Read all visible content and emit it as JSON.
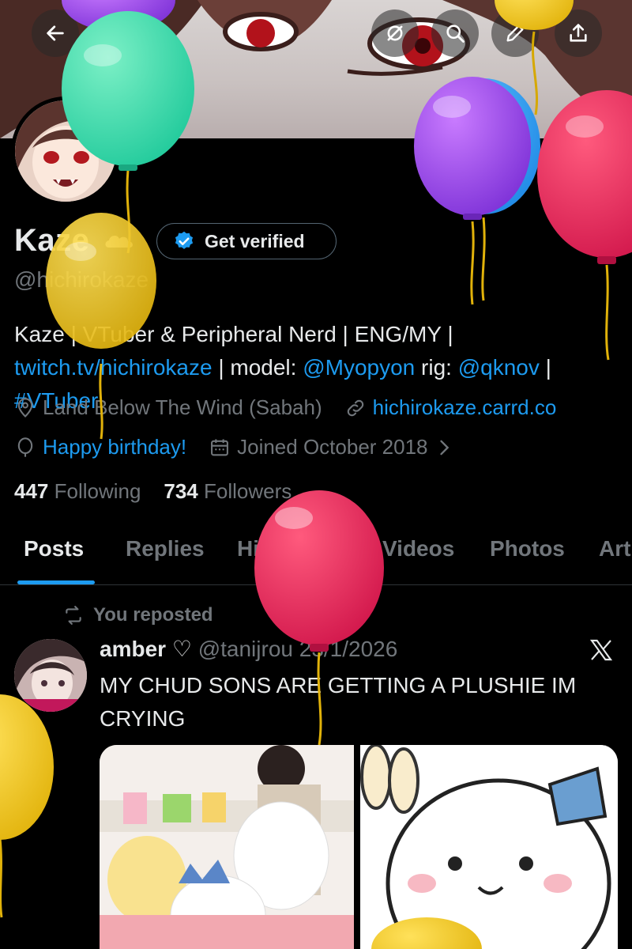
{
  "header": {
    "back_icon": "arrow-left-icon",
    "actions": [
      "mute-icon",
      "search-icon",
      "edit-icon",
      "share-icon"
    ]
  },
  "profile": {
    "name": "Kaze",
    "verify_label": "Get verified",
    "handle": "@hichirokaze",
    "bio": {
      "part1": "Kaze | VTuber & Peripheral Nerd | ENG/MY | ",
      "link1": "twitch.tv/hichirokaze",
      "part2": " | model: ",
      "link2": "@Myopyon",
      "part3": " rig: ",
      "link3": "@qknov",
      "part4": " | ",
      "link4": "#VTuber"
    },
    "location": "Land Below The Wind (Sabah)",
    "website": "hichirokaze.carrd.co",
    "birthday": "Happy birthday!",
    "joined": "Joined October 2018",
    "following_count": "447",
    "following_label": "Following",
    "followers_count": "734",
    "followers_label": "Followers"
  },
  "tabs": [
    "Posts",
    "Replies",
    "Highlights",
    "Videos",
    "Photos",
    "Art"
  ],
  "post": {
    "repost_label": "You reposted",
    "author": "amber ♡",
    "handle": "@tanijrou",
    "date": "23/1/2026",
    "text": "MY CHUD SONS ARE GETTING A PLUSHIE IM CRYING"
  },
  "colors": {
    "accent": "#1d9bf0",
    "muted": "#71767b",
    "text": "#e7e9ea",
    "background": "#000000"
  }
}
